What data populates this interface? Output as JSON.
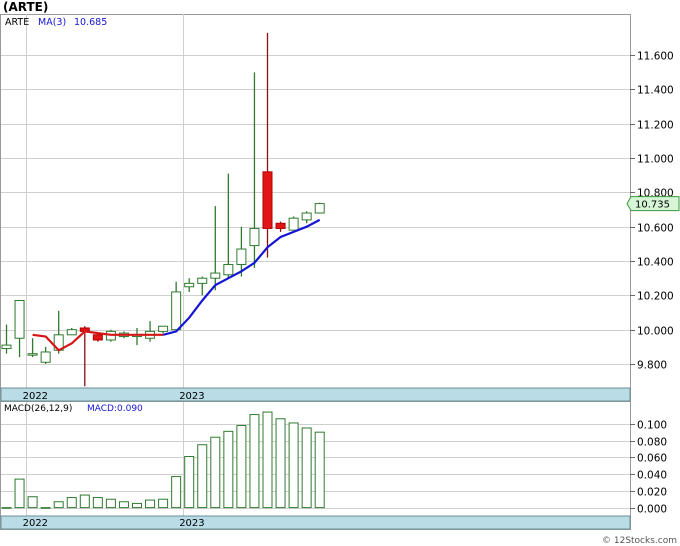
{
  "chart_data": [
    {
      "type": "candlestick",
      "title": "(ARTE)",
      "legend": {
        "ticker": "ARTE",
        "ma_label": "MA(3)",
        "ma_value": "10.685"
      },
      "last_price_label": "10.735",
      "last_price": 10.735,
      "ylim": [
        9.66,
        11.84
      ],
      "y_ticks": [
        9.8,
        10.0,
        10.2,
        10.4,
        10.6,
        10.8,
        11.0,
        11.2,
        11.4,
        11.6
      ],
      "y_tick_labels": [
        "9.800",
        "10.000",
        "10.200",
        "10.400",
        "10.600",
        "10.800",
        "11.000",
        "11.200",
        "11.400",
        "11.600"
      ],
      "x_labels": [
        {
          "label": "2022",
          "index": 2
        },
        {
          "label": "2023",
          "index": 14
        }
      ],
      "candles": [
        {
          "o": 9.89,
          "c": 9.91,
          "h": 10.03,
          "l": 9.86,
          "color": "white"
        },
        {
          "o": 9.95,
          "c": 10.17,
          "h": 10.17,
          "l": 9.84,
          "color": "white"
        },
        {
          "o": 9.86,
          "c": 9.86,
          "h": 9.95,
          "l": 9.84,
          "color": "white"
        },
        {
          "o": 9.81,
          "c": 9.87,
          "h": 9.9,
          "l": 9.8,
          "color": "white"
        },
        {
          "o": 9.88,
          "c": 9.97,
          "h": 10.11,
          "l": 9.86,
          "color": "white"
        },
        {
          "o": 9.97,
          "c": 10.0,
          "h": 10.01,
          "l": 9.97,
          "color": "white"
        },
        {
          "o": 10.01,
          "c": 9.99,
          "h": 10.02,
          "l": 9.67,
          "color": "red"
        },
        {
          "o": 9.97,
          "c": 9.94,
          "h": 9.98,
          "l": 9.93,
          "color": "red"
        },
        {
          "o": 9.94,
          "c": 9.99,
          "h": 10.0,
          "l": 9.93,
          "color": "white"
        },
        {
          "o": 9.96,
          "c": 9.98,
          "h": 9.99,
          "l": 9.95,
          "color": "white"
        },
        {
          "o": 9.96,
          "c": 9.97,
          "h": 10.01,
          "l": 9.91,
          "color": "white"
        },
        {
          "o": 9.95,
          "c": 9.99,
          "h": 10.05,
          "l": 9.93,
          "color": "white"
        },
        {
          "o": 9.99,
          "c": 10.02,
          "h": 10.02,
          "l": 9.98,
          "color": "white"
        },
        {
          "o": 10.0,
          "c": 10.22,
          "h": 10.28,
          "l": 10.0,
          "color": "white"
        },
        {
          "o": 10.25,
          "c": 10.27,
          "h": 10.3,
          "l": 10.22,
          "color": "white"
        },
        {
          "o": 10.27,
          "c": 10.3,
          "h": 10.31,
          "l": 10.2,
          "color": "white"
        },
        {
          "o": 10.3,
          "c": 10.33,
          "h": 10.72,
          "l": 10.23,
          "color": "white"
        },
        {
          "o": 10.32,
          "c": 10.38,
          "h": 10.91,
          "l": 10.3,
          "color": "white"
        },
        {
          "o": 10.38,
          "c": 10.47,
          "h": 10.6,
          "l": 10.31,
          "color": "white"
        },
        {
          "o": 10.49,
          "c": 10.59,
          "h": 11.5,
          "l": 10.36,
          "color": "white"
        },
        {
          "o": 10.92,
          "c": 10.59,
          "h": 11.73,
          "l": 10.42,
          "color": "red"
        },
        {
          "o": 10.62,
          "c": 10.59,
          "h": 10.63,
          "l": 10.57,
          "color": "red"
        },
        {
          "o": 10.58,
          "c": 10.65,
          "h": 10.66,
          "l": 10.58,
          "color": "white"
        },
        {
          "o": 10.64,
          "c": 10.68,
          "h": 10.69,
          "l": 10.62,
          "color": "white"
        },
        {
          "o": 10.68,
          "c": 10.735,
          "h": 10.74,
          "l": 10.68,
          "color": "white"
        }
      ],
      "ma_series": {
        "name": "MA(3)",
        "start_index": 2,
        "values": [
          9.97,
          9.96,
          9.88,
          9.92,
          9.99,
          9.98,
          9.97,
          9.97,
          9.97,
          9.97,
          9.97,
          9.99,
          10.07,
          10.17,
          10.26,
          10.3,
          10.34,
          10.39,
          10.48,
          10.54,
          10.57,
          10.6,
          10.64
        ]
      },
      "ma_red_until_index": 12
    },
    {
      "type": "bar",
      "title": "MACD(26,12,9)",
      "legend": {
        "label": "MACD(26,12,9)",
        "value_label": "MACD:0.090"
      },
      "ylim": [
        -0.01,
        0.126
      ],
      "y_ticks": [
        0.0,
        0.02,
        0.04,
        0.06,
        0.08,
        0.1
      ],
      "y_tick_labels": [
        "0.000",
        "0.020",
        "0.040",
        "0.060",
        "0.080",
        "0.100"
      ],
      "x_labels": [
        {
          "label": "2022",
          "index": 2
        },
        {
          "label": "2023",
          "index": 14
        }
      ],
      "values": [
        0.0,
        0.034,
        0.013,
        0.0,
        0.007,
        0.012,
        0.015,
        0.012,
        0.01,
        0.007,
        0.005,
        0.009,
        0.01,
        0.037,
        0.061,
        0.075,
        0.084,
        0.091,
        0.098,
        0.111,
        0.114,
        0.106,
        0.101,
        0.095,
        0.09
      ]
    }
  ],
  "watermark": "© 12Stocks.com"
}
